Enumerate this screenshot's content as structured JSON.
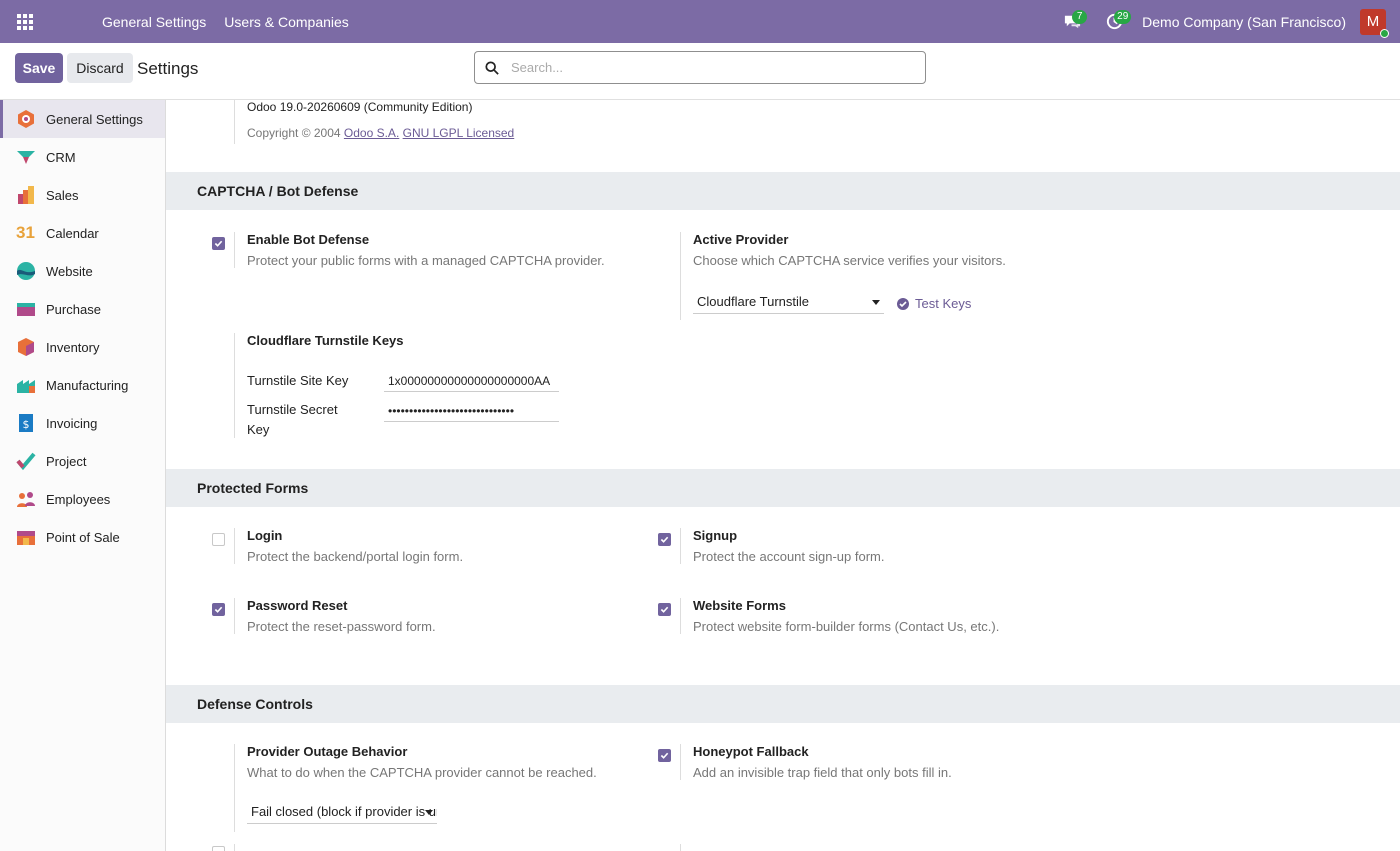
{
  "topbar": {
    "menu": [
      "General Settings",
      "Users & Companies"
    ],
    "messages_count": "7",
    "activities_count": "29",
    "company": "Demo Company (San Francisco)",
    "avatar_letter": "M"
  },
  "control": {
    "save_label": "Save",
    "discard_label": "Discard",
    "title": "Settings",
    "search_placeholder": "Search..."
  },
  "sidebar": {
    "items": [
      {
        "label": "General Settings",
        "icon": "general-settings-icon"
      },
      {
        "label": "CRM",
        "icon": "crm-icon"
      },
      {
        "label": "Sales",
        "icon": "sales-icon"
      },
      {
        "label": "Calendar",
        "icon": "calendar-icon"
      },
      {
        "label": "Website",
        "icon": "website-icon"
      },
      {
        "label": "Purchase",
        "icon": "purchase-icon"
      },
      {
        "label": "Inventory",
        "icon": "inventory-icon"
      },
      {
        "label": "Manufacturing",
        "icon": "manufacturing-icon"
      },
      {
        "label": "Invoicing",
        "icon": "invoicing-icon"
      },
      {
        "label": "Project",
        "icon": "project-icon"
      },
      {
        "label": "Employees",
        "icon": "employees-icon"
      },
      {
        "label": "Point of Sale",
        "icon": "point-of-sale-icon"
      }
    ],
    "calendar_day": "31"
  },
  "about": {
    "version": "Odoo 19.0-20260609 (Community Edition)",
    "copyright": "Copyright © 2004",
    "link_company": "Odoo S.A.",
    "link_license": "GNU LGPL Licensed"
  },
  "captcha": {
    "title": "CAPTCHA / Bot Defense",
    "enable": {
      "title": "Enable Bot Defense",
      "desc": "Protect your public forms with a managed CAPTCHA provider.",
      "checked": true
    },
    "provider": {
      "title": "Active Provider",
      "desc": "Choose which CAPTCHA service verifies your visitors.",
      "value": "Cloudflare Turnstile",
      "test_label": "Test Keys"
    },
    "keys": {
      "title": "Cloudflare Turnstile Keys",
      "site_key_label": "Turnstile Site Key",
      "site_key_value": "1x00000000000000000000AA",
      "secret_key_label_1": "Turnstile Secret",
      "secret_key_label_2": "Key",
      "secret_key_value": "••••••••••••••••••••••••••••••"
    }
  },
  "protected": {
    "title": "Protected Forms",
    "login": {
      "title": "Login",
      "desc": "Protect the backend/portal login form.",
      "checked": false
    },
    "signup": {
      "title": "Signup",
      "desc": "Protect the account sign-up form.",
      "checked": true
    },
    "reset": {
      "title": "Password Reset",
      "desc": "Protect the reset-password form.",
      "checked": true
    },
    "website": {
      "title": "Website Forms",
      "desc": "Protect website form-builder forms (Contact Us, etc.).",
      "checked": true
    }
  },
  "defense": {
    "title": "Defense Controls",
    "outage": {
      "title": "Provider Outage Behavior",
      "desc": "What to do when the CAPTCHA provider cannot be reached.",
      "value": "Fail closed (block if provider is unreachable)"
    },
    "honeypot": {
      "title": "Honeypot Fallback",
      "desc": "Add an invisible trap field that only bots fill in.",
      "checked": true
    }
  },
  "colors": {
    "brand": "#7c6ba5",
    "accent": "#71639e",
    "badge": "#28a745"
  }
}
